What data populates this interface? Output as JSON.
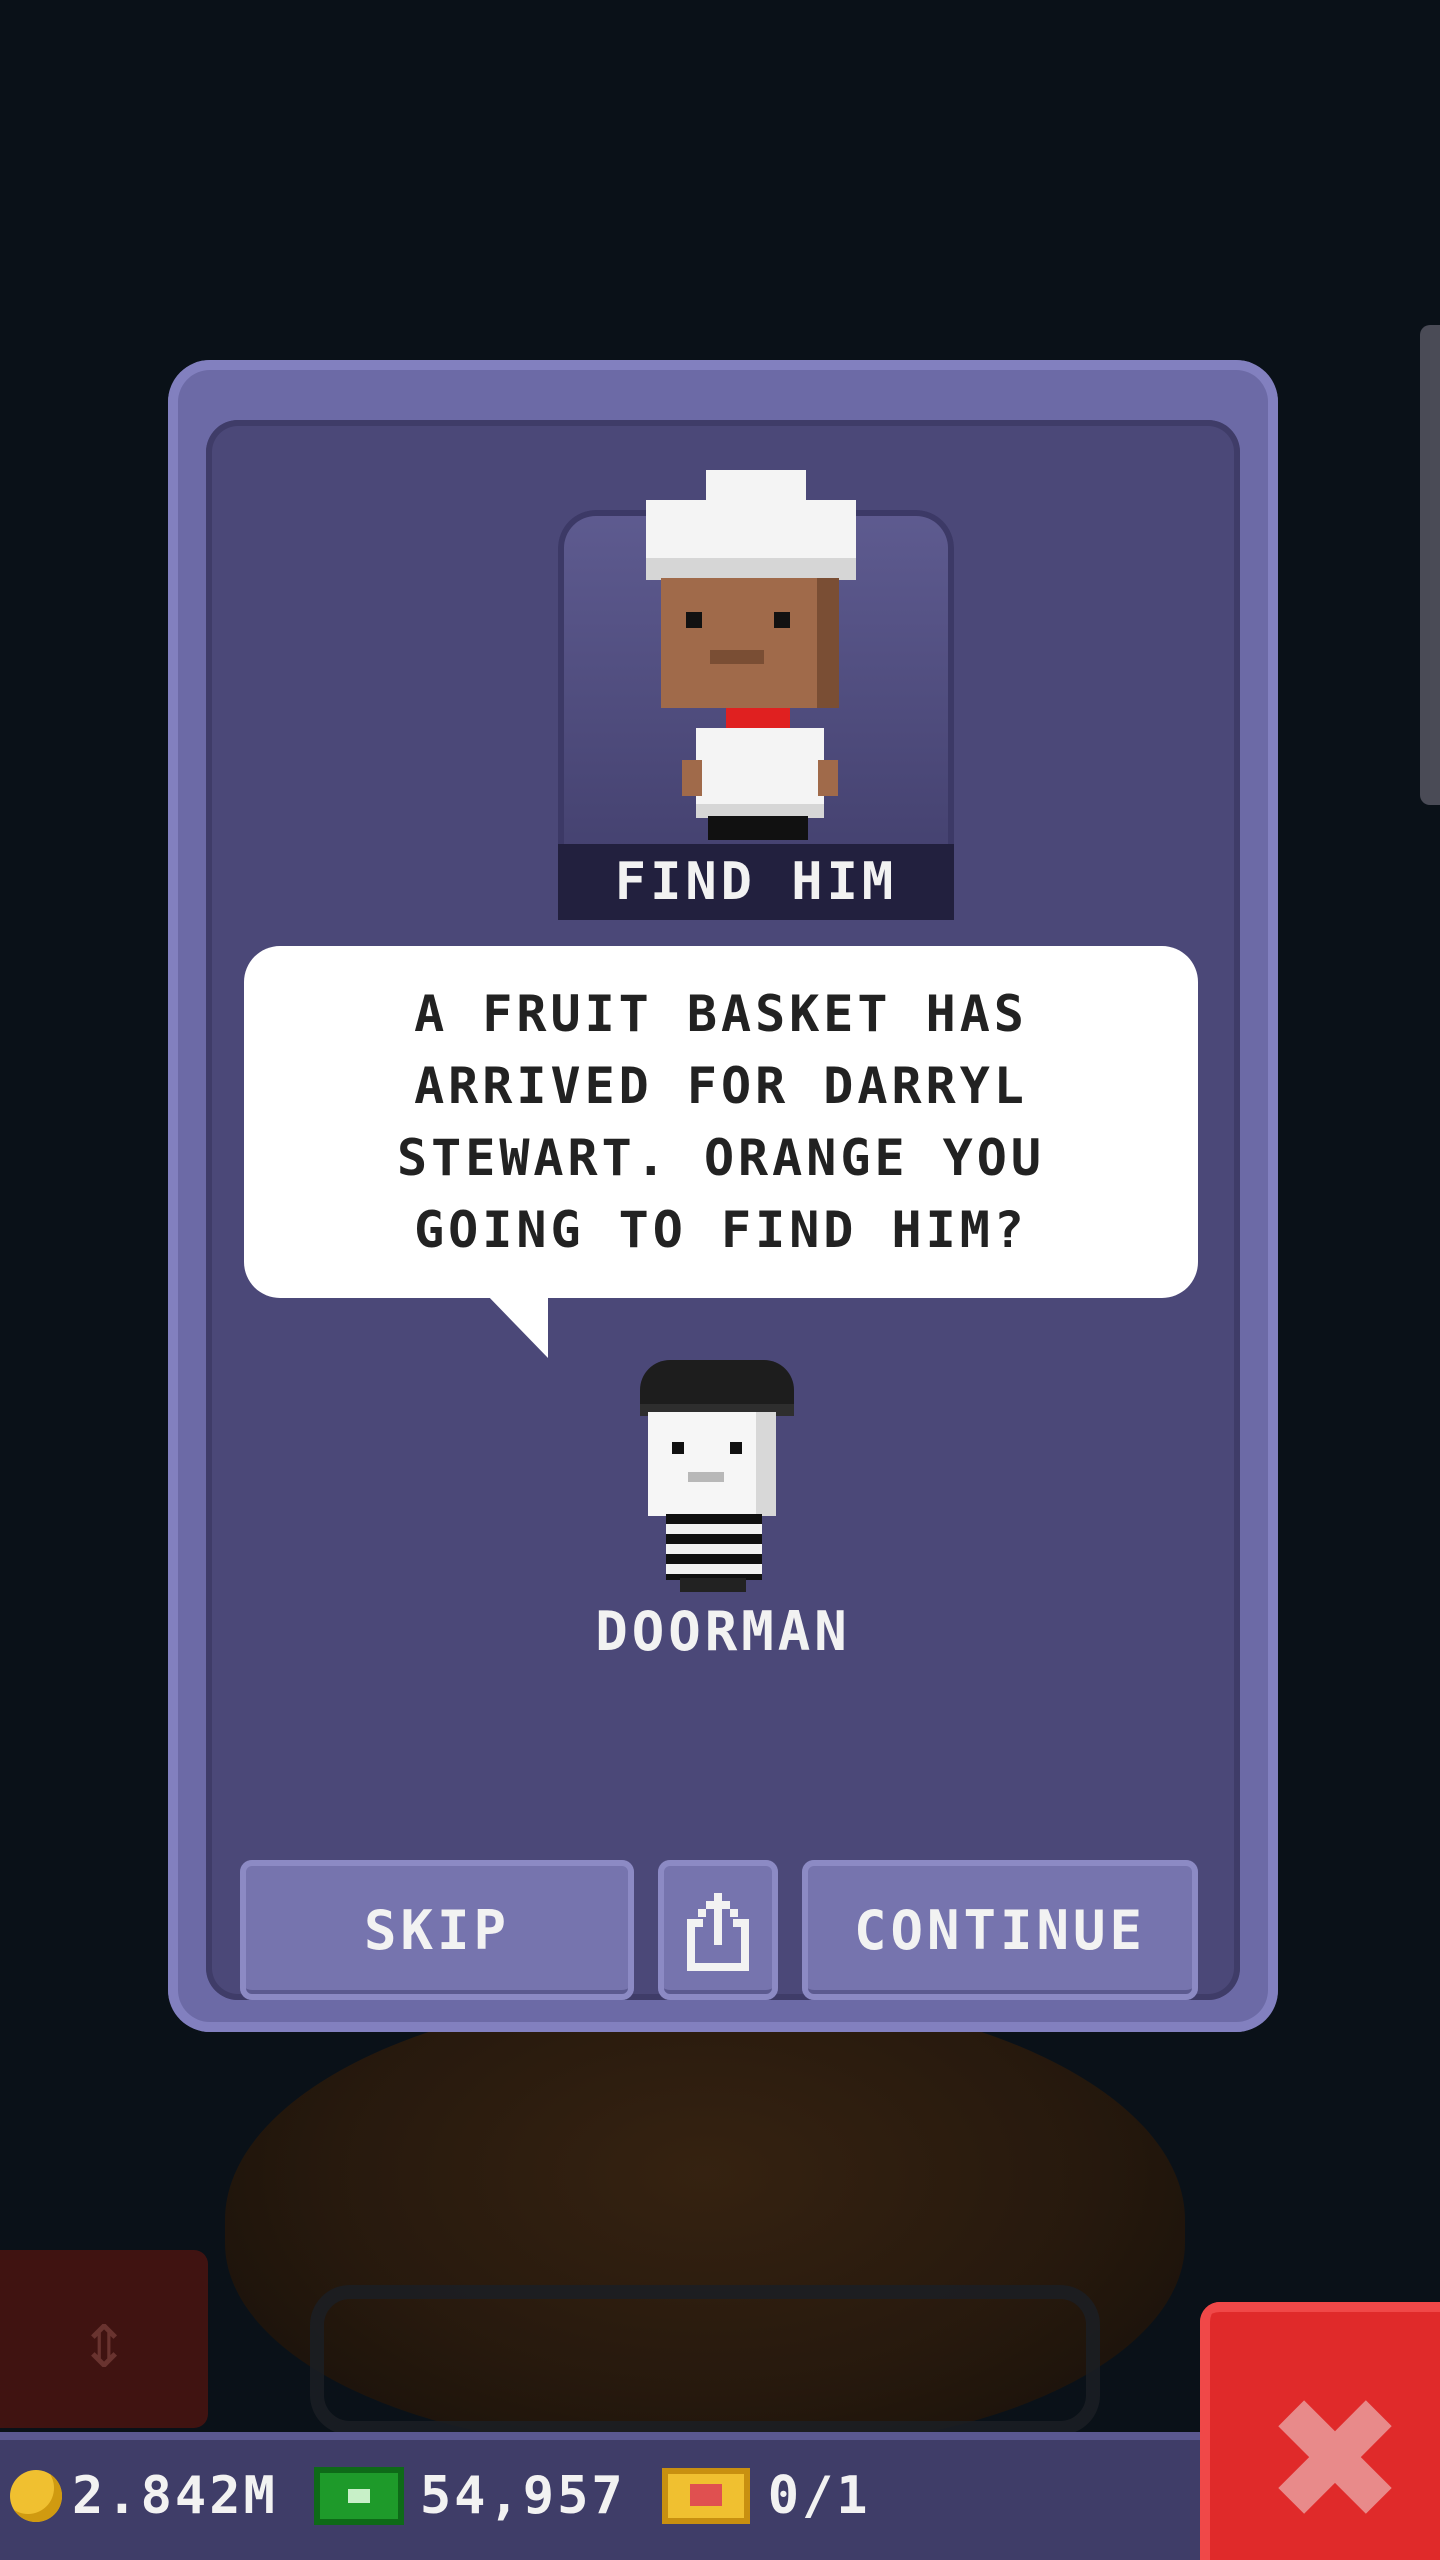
{
  "dialog": {
    "portrait_label": "FIND HIM",
    "message": "A FRUIT BASKET HAS ARRIVED FOR DARRYL STEWART. ORANGE YOU GOING TO FIND HIM?",
    "speaker": "DOORMAN",
    "buttons": {
      "skip": "SKIP",
      "continue": "CONTINUE"
    }
  },
  "hud": {
    "coins": "2.842M",
    "bux": "54,957",
    "tickets": "0/1"
  },
  "icons": {
    "portrait": "chef-icon",
    "speaker": "doorman-icon",
    "share": "share-icon",
    "coin": "coin-icon",
    "bux": "cash-icon",
    "ticket": "ticket-icon",
    "close": "close-icon",
    "elevator": "elevator-icon"
  },
  "colors": {
    "panel": "#6c6aa6",
    "panel_inner": "#4b4878",
    "close_button": "#e02a2a",
    "background": "#0a1118"
  }
}
